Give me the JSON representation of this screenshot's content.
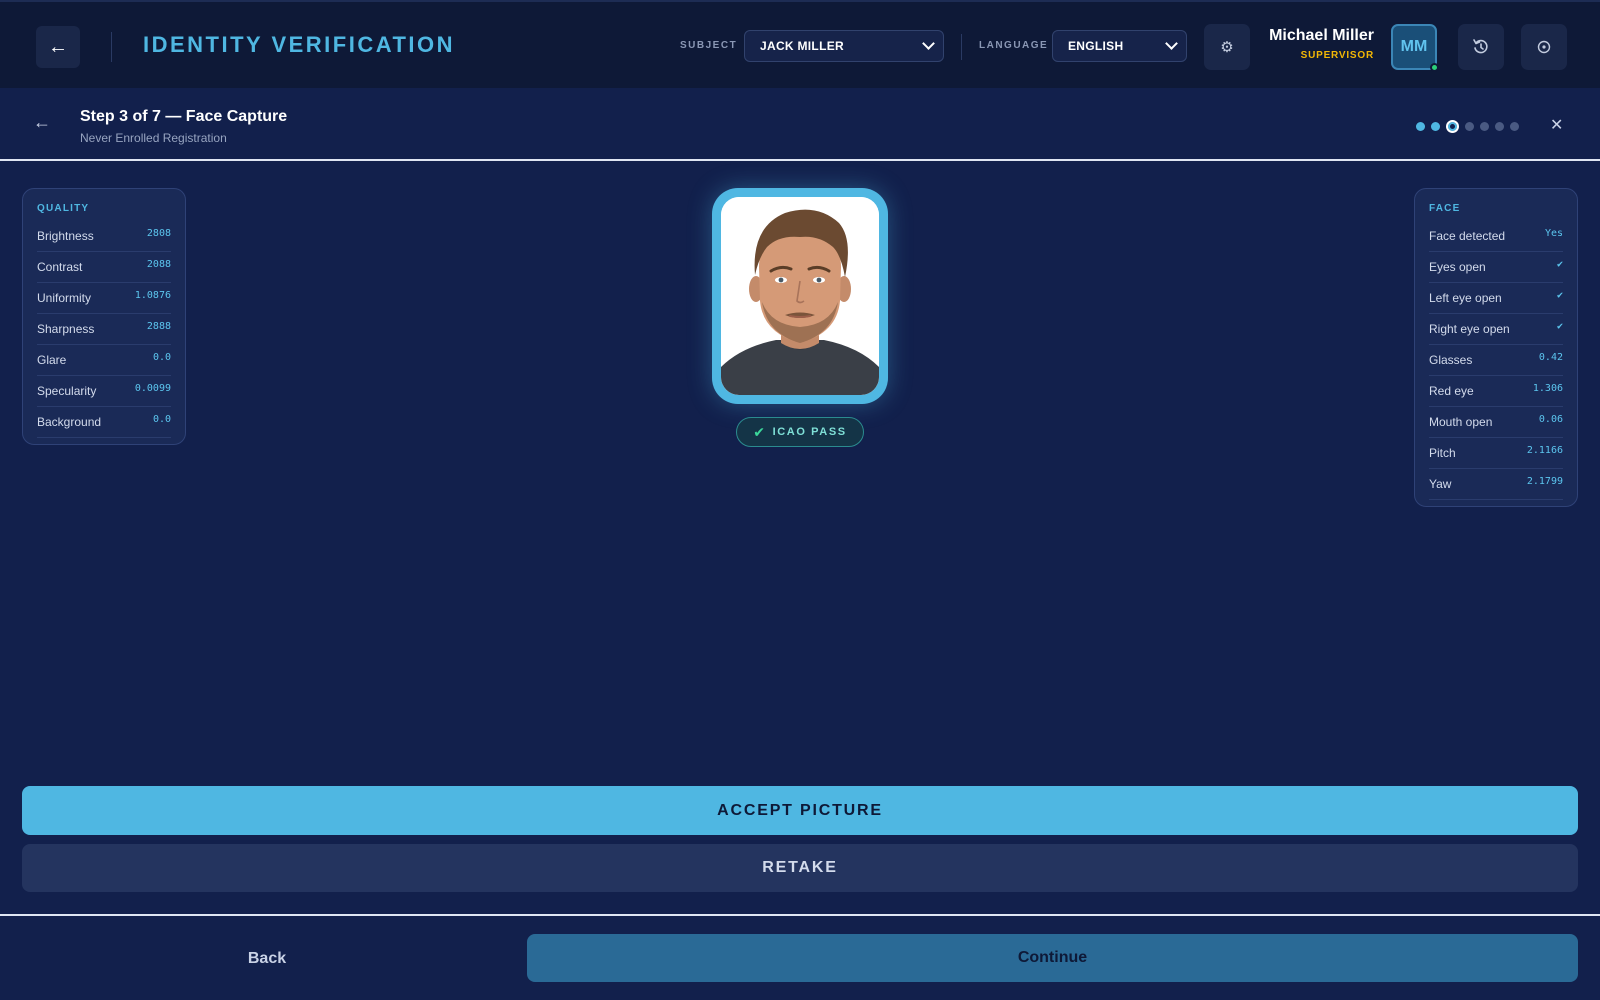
{
  "header": {
    "app_title": "IDENTITY VERIFICATION",
    "subject_label": "SUBJECT",
    "subject_value": "JACK MILLER",
    "language_label": "LANGUAGE",
    "language_value": "ENGLISH",
    "user_name": "Michael Miller",
    "user_role": "SUPERVISOR",
    "user_initials": "MM",
    "user_status": "online",
    "icons": [
      "back-arrow-icon",
      "settings-icon",
      "history-icon",
      "power-icon"
    ]
  },
  "step": {
    "title": "Step 3 of 7 — Face Capture",
    "subtitle": "Never Enrolled Registration",
    "current": 3,
    "total": 7
  },
  "quality": {
    "title": "QUALITY",
    "rows": [
      {
        "label": "Brightness",
        "value": "2808"
      },
      {
        "label": "Contrast",
        "value": "2088"
      },
      {
        "label": "Uniformity",
        "value": "1.0876"
      },
      {
        "label": "Sharpness",
        "value": "2888"
      },
      {
        "label": "Glare",
        "value": "0.0"
      },
      {
        "label": "Specularity",
        "value": "0.0099"
      },
      {
        "label": "Background",
        "value": "0.0"
      }
    ]
  },
  "face": {
    "title": "FACE",
    "rows": [
      {
        "label": "Face detected",
        "value": "Yes"
      },
      {
        "label": "Eyes open",
        "value": "✔"
      },
      {
        "label": "Left eye open",
        "value": "✔"
      },
      {
        "label": "Right eye open",
        "value": "✔"
      },
      {
        "label": "Glasses",
        "value": "0.42"
      },
      {
        "label": "Red eye",
        "value": "1.306"
      },
      {
        "label": "Mouth open",
        "value": "0.06"
      },
      {
        "label": "Pitch",
        "value": "2.1166"
      },
      {
        "label": "Yaw",
        "value": "2.1799"
      }
    ]
  },
  "capture": {
    "icao_status": "ICAO PASS"
  },
  "actions": {
    "accept_label": "ACCEPT PICTURE",
    "retake_label": "RETAKE"
  },
  "footer": {
    "back_label": "Back",
    "continue_label": "Continue"
  },
  "colors": {
    "accent": "#4fb7e2",
    "background": "#12204c",
    "topbar": "#0e1937",
    "role": "#f2b705",
    "pass": "#3bd79a"
  }
}
